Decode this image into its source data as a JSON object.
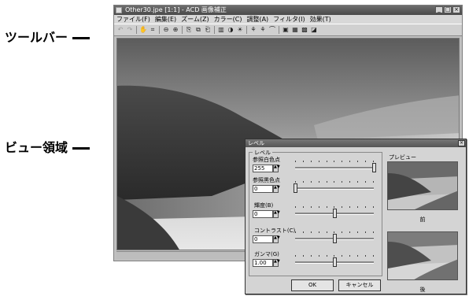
{
  "callouts": {
    "toolbar": "ツールバー",
    "view": "ビュー領域"
  },
  "window": {
    "title": "Other30.jpe [1:1] - ACD 画像補正",
    "buttons": [
      "_",
      "□",
      "×"
    ]
  },
  "menu": [
    "ファイル(F)",
    "編集(E)",
    "ズーム(Z)",
    "カラー(C)",
    "調整(A)",
    "フィルタ(I)",
    "効果(T)"
  ],
  "toolbar_icons": [
    {
      "name": "undo-icon",
      "glyph": "↶"
    },
    {
      "name": "redo-icon",
      "glyph": "↷"
    },
    {
      "name": "pan-hand-icon",
      "glyph": "✋"
    },
    {
      "name": "crop-icon",
      "glyph": "⌗"
    },
    {
      "name": "zoom-out-icon",
      "glyph": "⊖"
    },
    {
      "name": "zoom-in-icon",
      "glyph": "⊕"
    },
    {
      "name": "copy-icon",
      "glyph": "⎘"
    },
    {
      "name": "copy-merge-icon",
      "glyph": "⧉"
    },
    {
      "name": "paste-icon",
      "glyph": "⎗"
    },
    {
      "name": "levels-icon",
      "glyph": "▥"
    },
    {
      "name": "contrast-icon",
      "glyph": "◑"
    },
    {
      "name": "brightness-icon",
      "glyph": "☀"
    },
    {
      "name": "effect-1-icon",
      "glyph": "⚘"
    },
    {
      "name": "effect-2-icon",
      "glyph": "⚘"
    },
    {
      "name": "effect-3-icon",
      "glyph": "⌒"
    },
    {
      "name": "image-1-icon",
      "glyph": "▣"
    },
    {
      "name": "image-2-icon",
      "glyph": "▦"
    },
    {
      "name": "image-3-icon",
      "glyph": "▩"
    },
    {
      "name": "image-4-icon",
      "glyph": "◪"
    }
  ],
  "dialog": {
    "title": "レベル",
    "group_label": "レベル",
    "rows": [
      {
        "label": "参照白色点",
        "value": "255",
        "level": 1.0
      },
      {
        "label": "参照黒色点",
        "value": "0",
        "level": 0.0
      },
      {
        "label": "輝度(B)",
        "value": "0",
        "level": 0.5
      },
      {
        "label": "コントラスト(C)",
        "value": "0",
        "level": 0.5
      },
      {
        "label": "ガンマ(G)",
        "value": "1.00",
        "level": 0.5
      }
    ],
    "preview_label": "プレビュー",
    "before_label": "前",
    "after_label": "後",
    "ok": "OK",
    "cancel": "キャンセル"
  }
}
